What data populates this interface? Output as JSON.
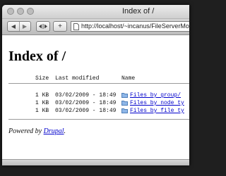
{
  "window": {
    "title": "Index of /"
  },
  "toolbar": {
    "url": "http://localhost/~incanus/FileServerModule6/da"
  },
  "page": {
    "heading": "Index of /",
    "columns": {
      "size": "Size",
      "modified": "Last modified",
      "name": "Name"
    },
    "rows": [
      {
        "size": "1 KB",
        "modified": "03/02/2009 - 18:49",
        "name": "Files by group/"
      },
      {
        "size": "1 KB",
        "modified": "03/02/2009 - 18:49",
        "name": "Files by node ty"
      },
      {
        "size": "1 KB",
        "modified": "03/02/2009 - 18:49",
        "name": "Files by file ty"
      }
    ],
    "footer": {
      "prefix": "Powered by ",
      "link": "Drupal",
      "suffix": "."
    }
  },
  "colors": {
    "link": "#0000cc",
    "desktop": "#1f1f1f",
    "folder": "#8fb7e8"
  },
  "icons": [
    "back-arrow-icon",
    "forward-arrow-icon",
    "page-icon",
    "folder-icon"
  ]
}
